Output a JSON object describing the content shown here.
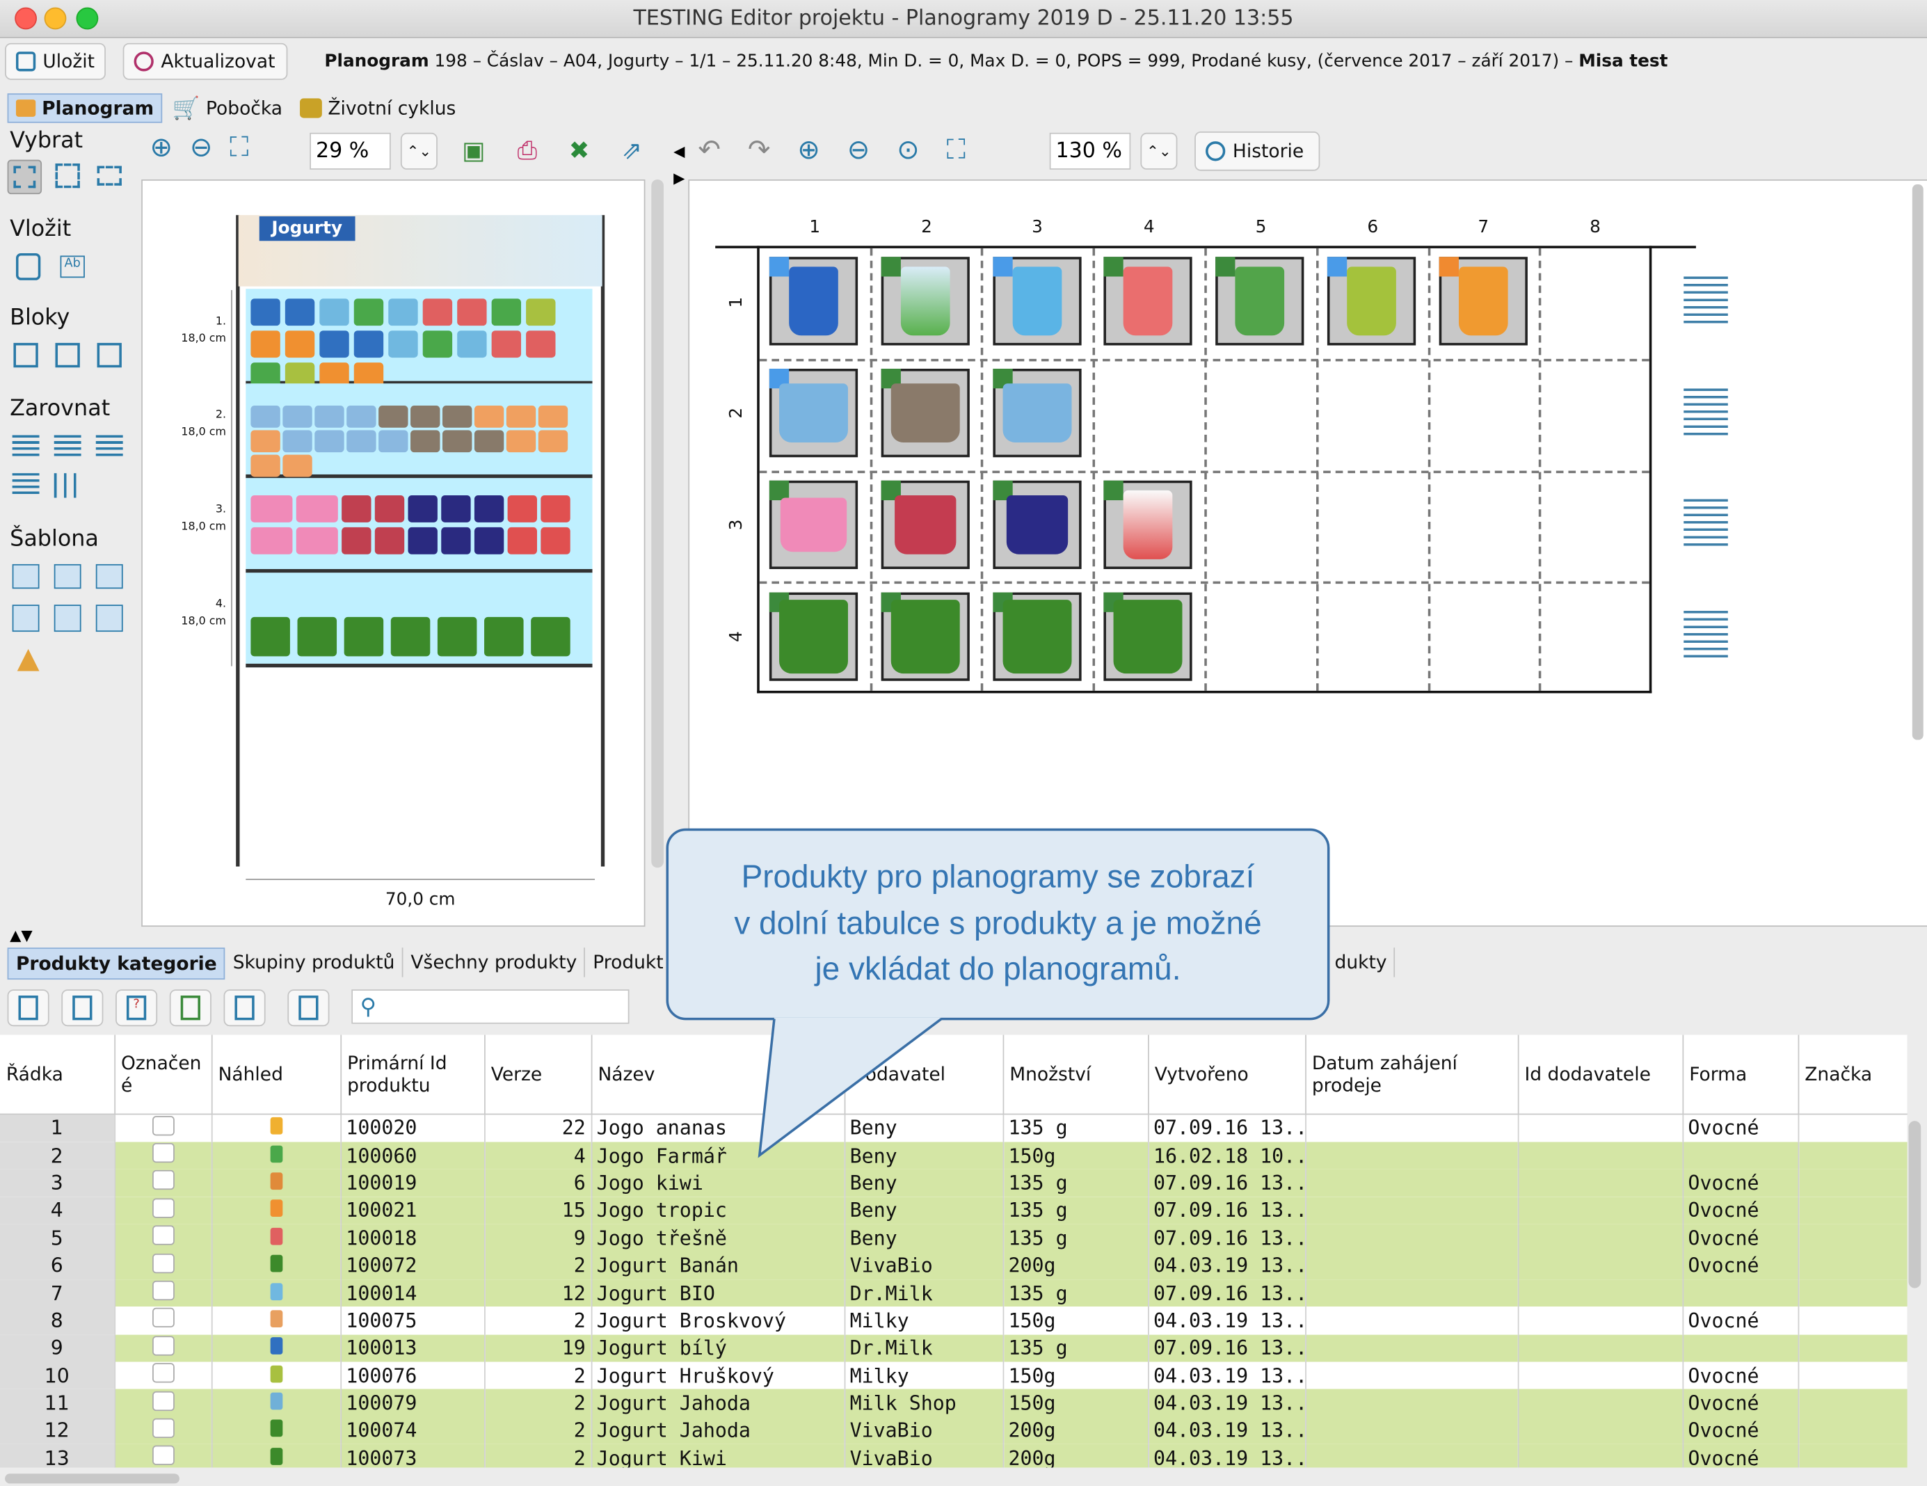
{
  "window": {
    "title": "TESTING Editor projektu - Planogramy 2019 D - 25.11.20 13:55"
  },
  "toolbar": {
    "save_label": "Uložit",
    "refresh_label": "Aktualizovat",
    "info_bold": "Planogram",
    "info_text": " 198 – Čáslav – A04, Jogurty – 1/1 – 25.11.20 8:48, Min D. = 0, Max D. = 0, POPS = 999, Prodané kusy, (července 2017 – září 2017) – ",
    "info_user": "Misa test"
  },
  "tabs": [
    "Planogram",
    "Pobočka",
    "Životní cyklus"
  ],
  "sidebar": {
    "select": "Vybrat",
    "insert": "Vložit",
    "blocks": "Bloky",
    "align": "Zarovnat",
    "template": "Šablona"
  },
  "left_view": {
    "zoom": "29 %",
    "header_label": "Jogurty",
    "width_label": "70,0 cm",
    "shelves": [
      {
        "num": "1.",
        "height": "18,0 cm"
      },
      {
        "num": "2.",
        "height": "18,0 cm"
      },
      {
        "num": "3.",
        "height": "18,0 cm"
      },
      {
        "num": "4.",
        "height": "18,0 cm"
      }
    ]
  },
  "right_view": {
    "zoom": "130 %",
    "history_label": "Historie",
    "columns": [
      "1",
      "2",
      "3",
      "4",
      "5",
      "6",
      "7",
      "8"
    ],
    "rows": [
      "1",
      "2",
      "3",
      "4"
    ]
  },
  "bottom_tabs": [
    "Produkty kategorie",
    "Skupiny produktů",
    "Všechny produkty",
    "Produkt",
    "dukty"
  ],
  "search": {
    "placeholder": ""
  },
  "table": {
    "headers": [
      "Řádka",
      "Označen\né",
      "Náhled",
      "Primární Id\nproduktu",
      "Verze",
      "Název",
      "Dodavatel",
      "Množství",
      "Vytvořeno",
      "Datum zahájení\nprodeje",
      "Id dodavatele",
      "Forma",
      "Značka"
    ],
    "rows": [
      {
        "n": "1",
        "id": "100020",
        "ver": "22",
        "name": "Jogo ananas",
        "sup": "Beny",
        "qty": "135 g",
        "created": "07.09.16 13...",
        "form": "Ovocné",
        "hl": false,
        "thumb": "#f0b030"
      },
      {
        "n": "2",
        "id": "100060",
        "ver": "4",
        "name": "Jogo Farmář",
        "sup": "Beny",
        "qty": "150g",
        "created": "16.02.18 10...",
        "form": "",
        "hl": true,
        "thumb": "#4aa84a"
      },
      {
        "n": "3",
        "id": "100019",
        "ver": "6",
        "name": "Jogo kiwi",
        "sup": "Beny",
        "qty": "135 g",
        "created": "07.09.16 13...",
        "form": "Ovocné",
        "hl": true,
        "thumb": "#e08a3a"
      },
      {
        "n": "4",
        "id": "100021",
        "ver": "15",
        "name": "Jogo tropic",
        "sup": "Beny",
        "qty": "135 g",
        "created": "07.09.16 13...",
        "form": "Ovocné",
        "hl": true,
        "thumb": "#f09030"
      },
      {
        "n": "5",
        "id": "100018",
        "ver": "9",
        "name": "Jogo třešně",
        "sup": "Beny",
        "qty": "135 g",
        "created": "07.09.16 13...",
        "form": "Ovocné",
        "hl": true,
        "thumb": "#e06060"
      },
      {
        "n": "6",
        "id": "100072",
        "ver": "2",
        "name": "Jogurt Banán",
        "sup": "VivaBio",
        "qty": "200g",
        "created": "04.03.19 13...",
        "form": "Ovocné",
        "hl": true,
        "thumb": "#3c8a2a"
      },
      {
        "n": "7",
        "id": "100014",
        "ver": "12",
        "name": "Jogurt BIO",
        "sup": "Dr.Milk",
        "qty": "135 g",
        "created": "07.09.16 13...",
        "form": "",
        "hl": true,
        "thumb": "#70b8e0"
      },
      {
        "n": "8",
        "id": "100075",
        "ver": "2",
        "name": "Jogurt Broskvový",
        "sup": "Milky",
        "qty": "150g",
        "created": "04.03.19 13...",
        "form": "Ovocné",
        "hl": false,
        "thumb": "#e8a060"
      },
      {
        "n": "9",
        "id": "100013",
        "ver": "19",
        "name": "Jogurt bílý",
        "sup": "Dr.Milk",
        "qty": "135 g",
        "created": "07.09.16 13...",
        "form": "",
        "hl": true,
        "thumb": "#3070c0"
      },
      {
        "n": "10",
        "id": "100076",
        "ver": "2",
        "name": "Jogurt Hruškový",
        "sup": "Milky",
        "qty": "150g",
        "created": "04.03.19 13...",
        "form": "Ovocné",
        "hl": false,
        "thumb": "#a8c040"
      },
      {
        "n": "11",
        "id": "100079",
        "ver": "2",
        "name": "Jogurt Jahoda",
        "sup": "Milk Shop",
        "qty": "150g",
        "created": "04.03.19 13...",
        "form": "Ovocné",
        "hl": true,
        "thumb": "#70b0d8"
      },
      {
        "n": "12",
        "id": "100074",
        "ver": "2",
        "name": "Jogurt Jahoda",
        "sup": "VivaBio",
        "qty": "200g",
        "created": "04.03.19 13...",
        "form": "Ovocné",
        "hl": true,
        "thumb": "#3c8a2a"
      },
      {
        "n": "13",
        "id": "100073",
        "ver": "2",
        "name": "Jogurt Kiwi",
        "sup": "VivaBio",
        "qty": "200g",
        "created": "04.03.19 13...",
        "form": "Ovocné",
        "hl": true,
        "thumb": "#3c8a2a"
      }
    ]
  },
  "callout": {
    "line1": "Produkty pro planogramy se zobrazí",
    "line2": "v dolní tabulce s produkty a je možné",
    "line3": "je vkládat do planogramů."
  },
  "colors": {
    "accent": "#3a6fa6",
    "row_highlight": "#d4e6a5",
    "shelf": "#bff0ff",
    "flag_blue": "#4a9be8",
    "flag_green": "#3c8a3c",
    "flag_orange": "#f08a30"
  }
}
